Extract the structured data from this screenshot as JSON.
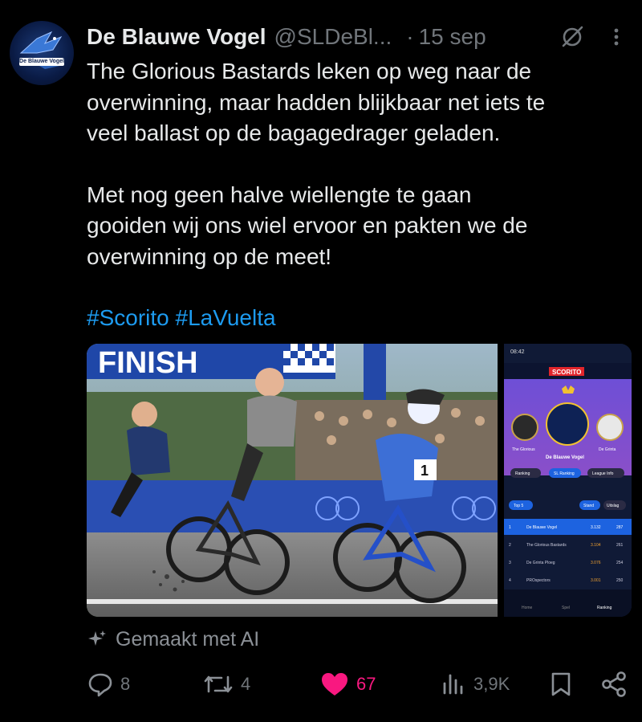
{
  "tweet": {
    "author_name": "De Blauwe Vogel",
    "handle": "@SLDeBl...",
    "separator": "·",
    "date": "15 sep",
    "avatar_text": "De Blauwe Vogel",
    "paragraphs": [
      "The Glorious Bastards leken op weg naar de\noverwinning, maar hadden blijkbaar net iets te\nveel ballast op de bagagedrager geladen.",
      "Met nog geen halve wiellengte te gaan\ngooiden wij ons wiel ervoor en pakten we de\noverwinning op de meet!"
    ],
    "hashtags": "#Scorito #LaVuelta",
    "ai_label": "Gemaakt met AI"
  },
  "media": {
    "main_image": {
      "banner_text": "FINISH",
      "bib_number": "1"
    },
    "phone_screenshot": {
      "status_time": "08:42",
      "app_name": "SCORITO",
      "team_name": "De Blauwe Vogel",
      "left_team": "The Glorious",
      "right_team": "De Grinta",
      "tabs": [
        "Ranking",
        "SL Ranking",
        "League Info"
      ],
      "filter_left": "Top 5",
      "filter_pills": [
        "Stand",
        "Uitslag"
      ],
      "rows": [
        {
          "rank": "1",
          "name": "De Blauwe Vogel",
          "points": "3.132",
          "extra": "287"
        },
        {
          "rank": "2",
          "name": "The Glorious Bastards",
          "points": "3.104",
          "extra": "261"
        },
        {
          "rank": "3",
          "name": "De Grinta Ploeg",
          "points": "3.076",
          "extra": "254"
        },
        {
          "rank": "4",
          "name": "PROspectors",
          "points": "3.001",
          "extra": "250"
        }
      ],
      "nav": [
        "Home",
        "Spel",
        "Ranking"
      ]
    }
  },
  "actions": {
    "replies": "8",
    "reposts": "4",
    "likes": "67",
    "views": "3,9K"
  },
  "colors": {
    "background": "#000000",
    "text": "#e7e9ea",
    "muted": "#71767b",
    "link": "#1d9bf0",
    "like": "#f91880"
  },
  "icons": [
    "grok-icon",
    "more-icon",
    "reply-icon",
    "repost-icon",
    "heart-icon",
    "views-icon",
    "bookmark-icon",
    "share-icon",
    "sparkle-icon"
  ]
}
